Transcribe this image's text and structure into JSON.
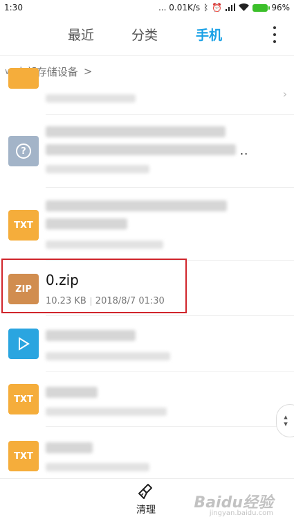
{
  "status_bar": {
    "time": "1:30",
    "network_speed": "... 0.01K/s",
    "battery_percent": "96%",
    "icons": [
      "bluetooth-icon",
      "alarm-icon",
      "signal-icon",
      "wifi-icon",
      "battery-icon"
    ]
  },
  "tabs": [
    {
      "label": "最近",
      "active": false
    },
    {
      "label": "分类",
      "active": false
    },
    {
      "label": "手机",
      "active": true
    }
  ],
  "accent_color": "#1aa1e6",
  "breadcrumb": {
    "label": "内部存储设备",
    "chevron": ">"
  },
  "files": [
    {
      "icon_type": "folder",
      "icon_color": "#f5ad3b",
      "name": "",
      "meta": ""
    },
    {
      "icon_type": "unknown",
      "icon_color": "#a3b4c8",
      "name": "",
      "meta": "",
      "truncation": ".."
    },
    {
      "icon_type": "txt",
      "icon_label": "TXT",
      "icon_color": "#f5ad3b",
      "name": "",
      "meta": ""
    },
    {
      "icon_type": "zip",
      "icon_label": "ZIP",
      "icon_color": "#d18d4f",
      "name": "0.zip",
      "size": "10.23 KB",
      "date": "2018/8/7 01:30",
      "highlighted": true
    },
    {
      "icon_type": "video",
      "icon_color": "#2aa5e0",
      "name": "",
      "meta": ""
    },
    {
      "icon_type": "txt",
      "icon_label": "TXT",
      "icon_color": "#f5ad3b",
      "name": "",
      "meta": ""
    },
    {
      "icon_type": "txt",
      "icon_label": "TXT",
      "icon_color": "#f5ad3b",
      "name": "",
      "meta": ""
    }
  ],
  "bottom_bar": {
    "clean_label": "清理",
    "watermark": "Baidu经验",
    "watermark_sub": "jingyan.baidu.com"
  }
}
